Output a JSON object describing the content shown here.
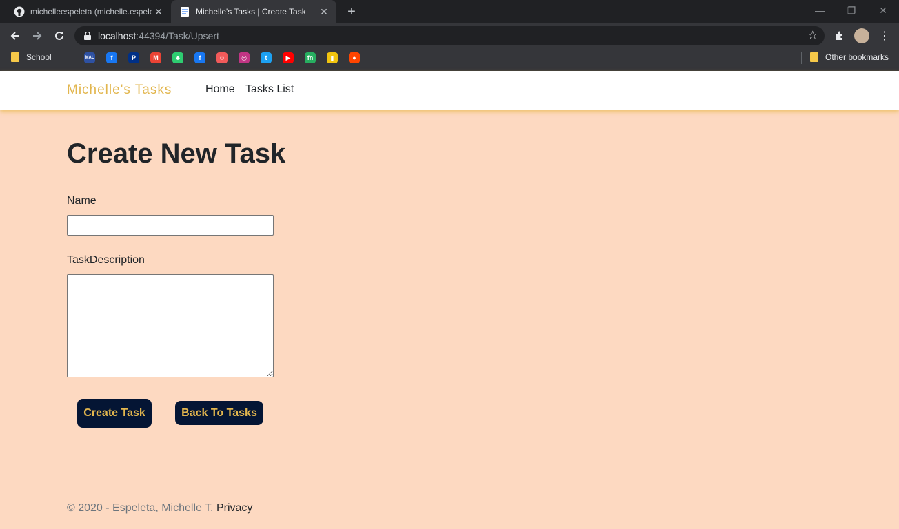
{
  "browser": {
    "tabs": [
      {
        "title": "michelleespeleta (michelle.espele",
        "icon": "github-icon",
        "active": false
      },
      {
        "title": "Michelle's Tasks | Create Task",
        "icon": "document-icon",
        "active": true
      }
    ],
    "url_host": "localhost",
    "url_path": ":44394/Task/Upsert",
    "bookmarks": {
      "school_label": "School",
      "other_label": "Other bookmarks",
      "icons": [
        {
          "name": "mal-bookmark-icon",
          "glyph": "MAL",
          "color": "#2e51a2"
        },
        {
          "name": "facebook-bookmark-icon",
          "glyph": "f",
          "color": "#1877f2"
        },
        {
          "name": "paypal-bookmark-icon",
          "glyph": "P",
          "color": "#003087"
        },
        {
          "name": "gmail-bookmark-icon",
          "glyph": "M",
          "color": "#ea4335"
        },
        {
          "name": "tree-bookmark-icon",
          "glyph": "♣",
          "color": "#2ecc71"
        },
        {
          "name": "facebook-bookmark-icon-2",
          "glyph": "f",
          "color": "#1877f2"
        },
        {
          "name": "messenger-bookmark-icon",
          "glyph": "☺",
          "color": "#f15a5a"
        },
        {
          "name": "instagram-bookmark-icon",
          "glyph": "◎",
          "color": "#c13584"
        },
        {
          "name": "twitter-bookmark-icon",
          "glyph": "t",
          "color": "#1da1f2"
        },
        {
          "name": "youtube-bookmark-icon",
          "glyph": "▶",
          "color": "#ff0000"
        },
        {
          "name": "fn-bookmark-icon",
          "glyph": "fn",
          "color": "#27ae60"
        },
        {
          "name": "notes-bookmark-icon",
          "glyph": "▮",
          "color": "#f1c40f"
        },
        {
          "name": "reddit-bookmark-icon",
          "glyph": "●",
          "color": "#ff4500"
        }
      ]
    }
  },
  "navbar": {
    "brand": "Michelle's Tasks",
    "links": [
      "Home",
      "Tasks List"
    ]
  },
  "main": {
    "title": "Create New Task",
    "name_label": "Name",
    "name_value": "",
    "description_label": "TaskDescription",
    "description_value": "",
    "create_button": "Create Task",
    "back_button": "Back To Tasks"
  },
  "footer": {
    "copyright": "© 2020 - Espeleta, Michelle T.",
    "privacy": "Privacy"
  },
  "colors": {
    "page_bg": "#fdd9c1",
    "accent": "#e2b64e",
    "button_bg": "#041534"
  }
}
